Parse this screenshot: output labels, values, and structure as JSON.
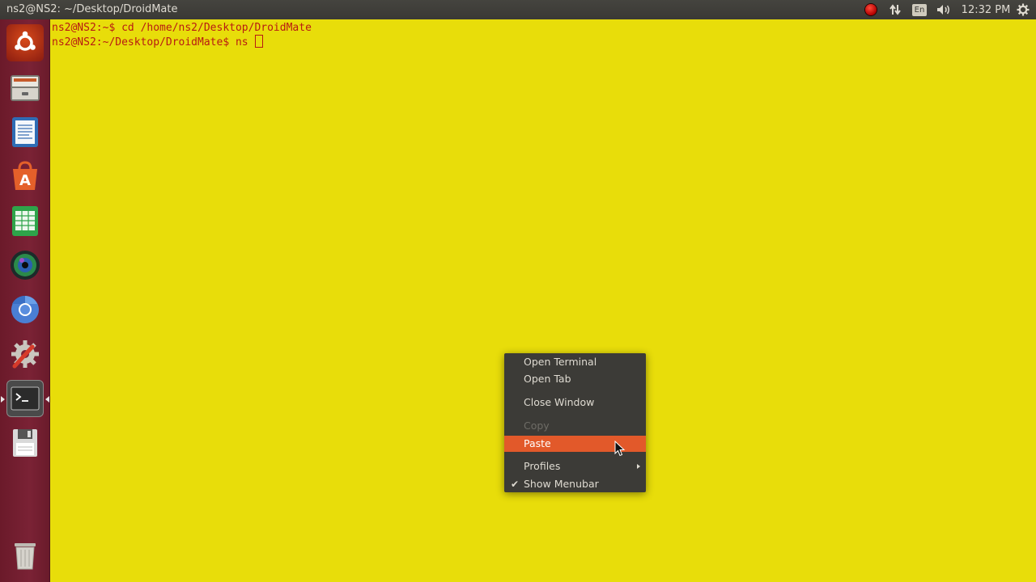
{
  "top_panel": {
    "window_title": "ns2@NS2: ~/Desktop/DroidMate",
    "keyboard_layout": "En",
    "clock": "12:32 PM",
    "icons": [
      "record-indicator-icon",
      "network-icon",
      "keyboard-layout-icon",
      "volume-icon",
      "settings-gear-icon"
    ]
  },
  "launcher": {
    "items": [
      {
        "name": "dash-home",
        "icon": "ubuntu-logo-icon"
      },
      {
        "name": "files",
        "icon": "file-cabinet-icon"
      },
      {
        "name": "libreoffice-writer",
        "icon": "writer-document-icon"
      },
      {
        "name": "software-center",
        "icon": "software-center-icon"
      },
      {
        "name": "libreoffice-calc",
        "icon": "spreadsheet-icon"
      },
      {
        "name": "shotwell",
        "icon": "photo-viewer-icon"
      },
      {
        "name": "chromium",
        "icon": "browser-icon"
      },
      {
        "name": "system-settings",
        "icon": "settings-tools-icon"
      },
      {
        "name": "terminal",
        "icon": "terminal-icon",
        "active": true
      },
      {
        "name": "save-disk",
        "icon": "floppy-disk-icon"
      },
      {
        "name": "trash",
        "icon": "trash-icon"
      }
    ]
  },
  "terminal": {
    "lines": [
      "ns2@NS2:~$ cd /home/ns2/Desktop/DroidMate",
      "ns2@NS2:~/Desktop/DroidMate$ ns "
    ],
    "background_color": "#e8dd0a",
    "text_color": "#b81a12"
  },
  "context_menu": {
    "items": [
      {
        "label": "Open Terminal",
        "enabled": true
      },
      {
        "label": "Open Tab",
        "enabled": true
      },
      {
        "label": "Close Window",
        "enabled": true
      },
      {
        "label": "Copy",
        "enabled": false
      },
      {
        "label": "Paste",
        "enabled": true,
        "highlighted": true
      },
      {
        "label": "Profiles",
        "enabled": true,
        "submenu": true
      },
      {
        "label": "Show Menubar",
        "enabled": true,
        "checked": true
      }
    ],
    "highlight_color": "#e2592a"
  }
}
